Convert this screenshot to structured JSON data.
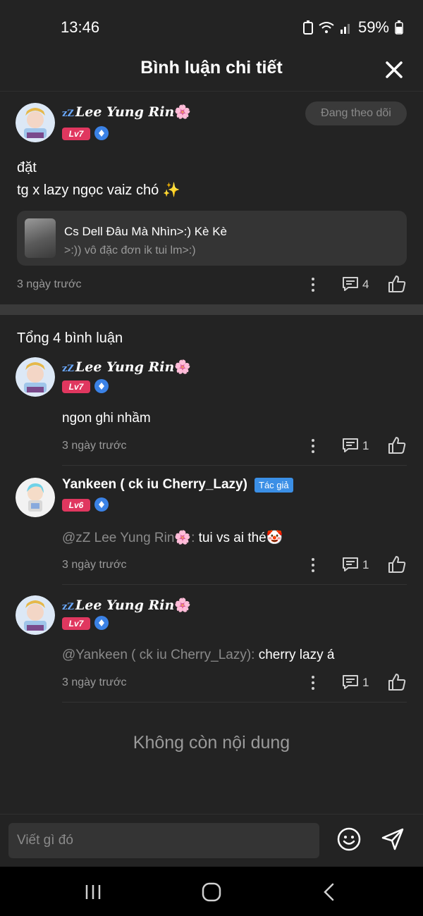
{
  "status": {
    "time": "13:46",
    "battery": "59%"
  },
  "header": {
    "title": "Bình luận chi tiết"
  },
  "post": {
    "user_zz": "zZ",
    "user_name": "Lee Yung Rin",
    "level": "Lv7",
    "follow_label": "Đang theo dõi",
    "text_line1": "đặt",
    "text_line2": "tg x lazy ngọc vaiz chó ✨",
    "quote_title": "Cs Dell Đâu Mà Nhìn>:) Kè Kè",
    "quote_sub": ">:)) vô đặc đơn ik tui lm>:)",
    "time": "3 ngày trước",
    "reply_count": "4"
  },
  "total_label": "Tổng 4 bình luận",
  "comments": [
    {
      "user_zz": "zZ",
      "user_name": "Lee Yung Rin",
      "level": "Lv7",
      "mention": "",
      "text": "ngon ghi nhầm",
      "time": "3 ngày trước",
      "reply_count": "1"
    },
    {
      "user_name": "Yankeen ( ck iu Cherry_Lazy)",
      "badge": "Tác giả",
      "level": "Lv6",
      "mention": "@zZ Lee Yung Rin🌸: ",
      "text": "tui vs ai thé🤡",
      "time": "3 ngày trước",
      "reply_count": "1"
    },
    {
      "user_zz": "zZ",
      "user_name": "Lee Yung Rin",
      "level": "Lv7",
      "mention": "@Yankeen ( ck iu Cherry_Lazy): ",
      "text": "cherry lazy á",
      "time": "3 ngày trước",
      "reply_count": "1"
    }
  ],
  "no_more": "Không còn nội dung",
  "composer": {
    "placeholder": "Viết gì đó"
  },
  "colors": {
    "background": "#232323",
    "level_red": "#e0375f",
    "verify_blue": "#3b82e6",
    "author_badge": "#3b8fe6"
  },
  "icons": [
    "close-icon",
    "more-icon",
    "reply-icon",
    "like-icon",
    "emoji-icon",
    "send-icon",
    "verified-icon",
    "recent-apps-icon",
    "home-icon",
    "back-icon"
  ]
}
